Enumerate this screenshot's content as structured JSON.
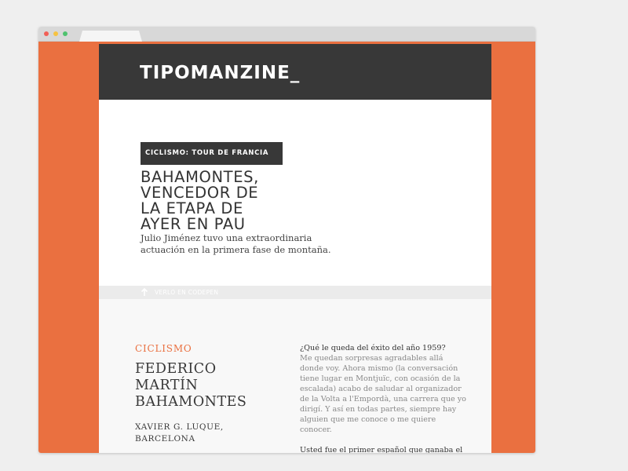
{
  "logo": "TIPOMANZINE_",
  "article": {
    "kicker": "CICLISMO: TOUR DE FRANCIA",
    "headline_lines": [
      "BAHAMONTES,",
      "VENCEDOR DE",
      "LA ETAPA DE",
      "AYER EN PAU"
    ],
    "subhead_lines": [
      "Julio Jiménez tuvo una extraordinaria",
      "actuación en la primera fase de montaña."
    ]
  },
  "codepen": {
    "icon": "arrow-up-icon",
    "label": "VERLO EN CODEPEN"
  },
  "feature": {
    "section": "CICLISMO",
    "name_lines": [
      "FEDERICO",
      "MARTÍN",
      "BAHAMONTES"
    ],
    "byline_lines": [
      "XAVIER G. LUQUE,",
      "BARCELONA"
    ],
    "question": "¿Qué le queda del éxito del año 1959?",
    "answer_lines": [
      "Me quedan sorpresas agradables allá",
      "donde voy. Ahora mismo (la conversación",
      "tiene lugar en Montjuïc, con ocasión de la",
      "escalada) acabo de saludar al organizador",
      "de la Volta a l'Empordà, una carrera que yo",
      "dirigí. Y así en todas partes, siempre hay",
      "alguien que me conoce o me quiere",
      "conocer."
    ],
    "question2": "Usted fue el primer español que ganaba el"
  },
  "colors": {
    "accent": "#ea7040",
    "dark": "#383838",
    "background": "#efefef"
  }
}
